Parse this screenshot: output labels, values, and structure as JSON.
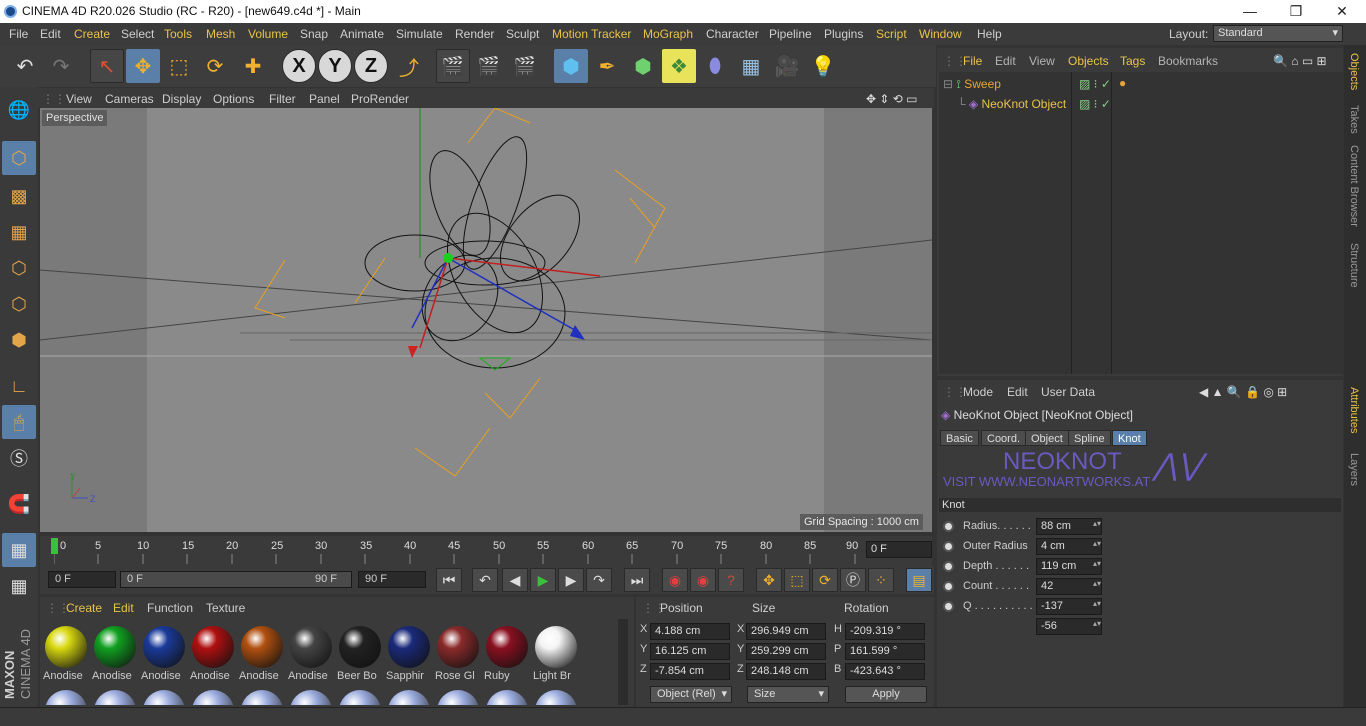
{
  "window": {
    "title": "CINEMA 4D R20.026 Studio (RC - R20) - [new649.c4d *] - Main",
    "min": "—",
    "max": "❐",
    "close": "✕"
  },
  "menubar": {
    "items": [
      "File",
      "Edit",
      "Create",
      "Select",
      "Tools",
      "Mesh",
      "Volume",
      "Snap",
      "Animate",
      "Simulate",
      "Render",
      "Sculpt",
      "Motion Tracker",
      "MoGraph",
      "Character",
      "Pipeline",
      "Plugins",
      "Script",
      "Window",
      "Help"
    ],
    "layout_label": "Layout:",
    "layout_value": "Standard"
  },
  "toolbar": {
    "undo": "↶",
    "redo": "↷",
    "select": "↖",
    "move": "✥",
    "scale": "⬚",
    "rotate": "⟳",
    "add": "✚",
    "x": "X",
    "y": "Y",
    "z": "Z",
    "coord": "⤴"
  },
  "viewport": {
    "menu": [
      "View",
      "Cameras",
      "Display",
      "Options",
      "Filter",
      "Panel",
      "ProRender"
    ],
    "camera": "Perspective",
    "grid_spacing": "Grid Spacing : 1000 cm",
    "axis_y": "Y",
    "axis_z": "Z"
  },
  "timeline": {
    "ticks": [
      "0",
      "5",
      "10",
      "15",
      "20",
      "25",
      "30",
      "35",
      "40",
      "45",
      "50",
      "55",
      "60",
      "65",
      "70",
      "75",
      "80",
      "85",
      "90"
    ],
    "current_frame": "0 F",
    "start": "0 F",
    "range_start": "0 F",
    "range_end": "90 F",
    "end": "90 F"
  },
  "materials": {
    "menu": [
      "Create",
      "Edit",
      "Function",
      "Texture"
    ],
    "items": [
      {
        "name": "Anodise",
        "color": "#d8d810"
      },
      {
        "name": "Anodise",
        "color": "#10a020"
      },
      {
        "name": "Anodise",
        "color": "#1a3a9a"
      },
      {
        "name": "Anodise",
        "color": "#b01010"
      },
      {
        "name": "Anodise",
        "color": "#b05010"
      },
      {
        "name": "Anodise",
        "color": "#444444"
      },
      {
        "name": "Beer Bo",
        "color": "#222222"
      },
      {
        "name": "Sapphir",
        "color": "#1a2a7a"
      },
      {
        "name": "Rose Gl",
        "color": "#8a2a2a"
      },
      {
        "name": "Ruby",
        "color": "#8a1020"
      },
      {
        "name": "Light Br",
        "color": "#f4f4f4"
      }
    ]
  },
  "coords": {
    "headers": [
      "Position",
      "Size",
      "Rotation"
    ],
    "rows": [
      {
        "axis": "X",
        "pos": "4.188 cm",
        "saxis": "X",
        "size": "296.949 cm",
        "raxis": "H",
        "rot": "-209.319 °"
      },
      {
        "axis": "Y",
        "pos": "16.125 cm",
        "saxis": "Y",
        "size": "259.299 cm",
        "raxis": "P",
        "rot": "161.599 °"
      },
      {
        "axis": "Z",
        "pos": "-7.854 cm",
        "saxis": "Z",
        "size": "248.148 cm",
        "raxis": "B",
        "rot": "-423.643 °"
      }
    ],
    "mode": "Object (Rel)",
    "size_mode": "Size",
    "apply": "Apply"
  },
  "objects": {
    "menu": [
      "File",
      "Edit",
      "View",
      "Objects",
      "Tags",
      "Bookmarks"
    ],
    "items": [
      {
        "name": "Sweep",
        "color": "#e8a43a"
      },
      {
        "name": "NeoKnot Object",
        "color": "#e8c34a"
      }
    ]
  },
  "attributes": {
    "menu": [
      "Mode",
      "Edit",
      "User Data"
    ],
    "object_title": "NeoKnot Object [NeoKnot Object]",
    "tabs": [
      "Basic",
      "Coord.",
      "Object",
      "Spline",
      "Knot"
    ],
    "active_tab": "Knot",
    "banner_title": "NEOKNOT",
    "banner_url": "VISIT WWW.NEONARTWORKS.AT",
    "section": "Knot",
    "params": [
      {
        "label": "Radius. . . . . .",
        "value": "88 cm"
      },
      {
        "label": "Outer Radius",
        "value": "4 cm"
      },
      {
        "label": "Depth . . . . . .",
        "value": "119 cm"
      },
      {
        "label": "Count . . . . . .",
        "value": "42"
      },
      {
        "label": "Q . . . . . . . . . .",
        "value": "-137"
      },
      {
        "label": "",
        "value": "-56"
      }
    ]
  },
  "right_tabs": {
    "top": [
      "Objects",
      "Takes",
      "Content Browser",
      "Structure"
    ],
    "bottom": [
      "Attributes",
      "Layers"
    ]
  },
  "brand": {
    "maxon": "MAXON",
    "product": "CINEMA 4D"
  }
}
